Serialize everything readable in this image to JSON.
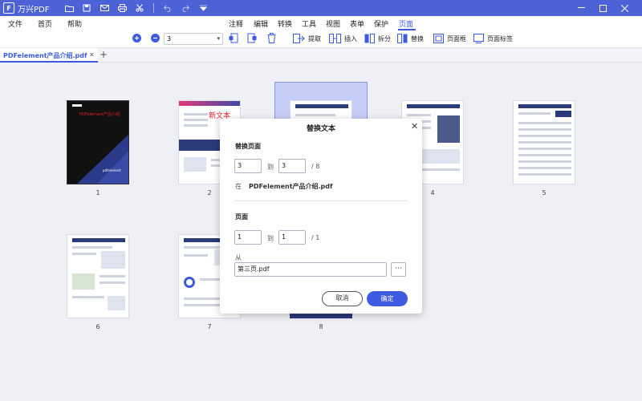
{
  "app": {
    "title": "万兴PDF",
    "logo_letter": "F"
  },
  "menu": {
    "items": [
      "文件",
      "首页",
      "帮助"
    ],
    "right_items": [
      "注释",
      "编辑",
      "转换",
      "工具",
      "视图",
      "表单",
      "保护",
      "页面"
    ],
    "active": "页面"
  },
  "toolbar": {
    "zoom_value": "3",
    "extract_label": "提取",
    "insert_label": "插入",
    "split_label": "拆分",
    "replace_label": "替换",
    "page_box_label": "页面框",
    "page_label_label": "页面标签"
  },
  "tab": {
    "name": "PDFelement产品介绍.pdf"
  },
  "pages": [
    {
      "num": "1",
      "cover_text": "PDFelement产品介绍",
      "brand": "pdfelement"
    },
    {
      "num": "2",
      "stamp_text": "新文本"
    },
    {
      "num": "3"
    },
    {
      "num": "4"
    },
    {
      "num": "5"
    },
    {
      "num": "6"
    },
    {
      "num": "7"
    },
    {
      "num": "8"
    }
  ],
  "dialog": {
    "title": "替换文本",
    "section_replace": "替换页面",
    "from_page": "3",
    "to_label": "到",
    "to_page": "3",
    "total": "/ 8",
    "in_label": "在",
    "in_file": "PDFelement产品介绍.pdf",
    "section_pages": "页面",
    "src_from": "1",
    "src_to_label": "到",
    "src_to": "1",
    "src_total": "/ 1",
    "from_label": "从",
    "src_file": "第三页.pdf",
    "browse_label": "···",
    "cancel_label": "取消",
    "ok_label": "确定"
  },
  "colors": {
    "accent": "#3d5ae0",
    "titlebar": "#4d62d6"
  }
}
